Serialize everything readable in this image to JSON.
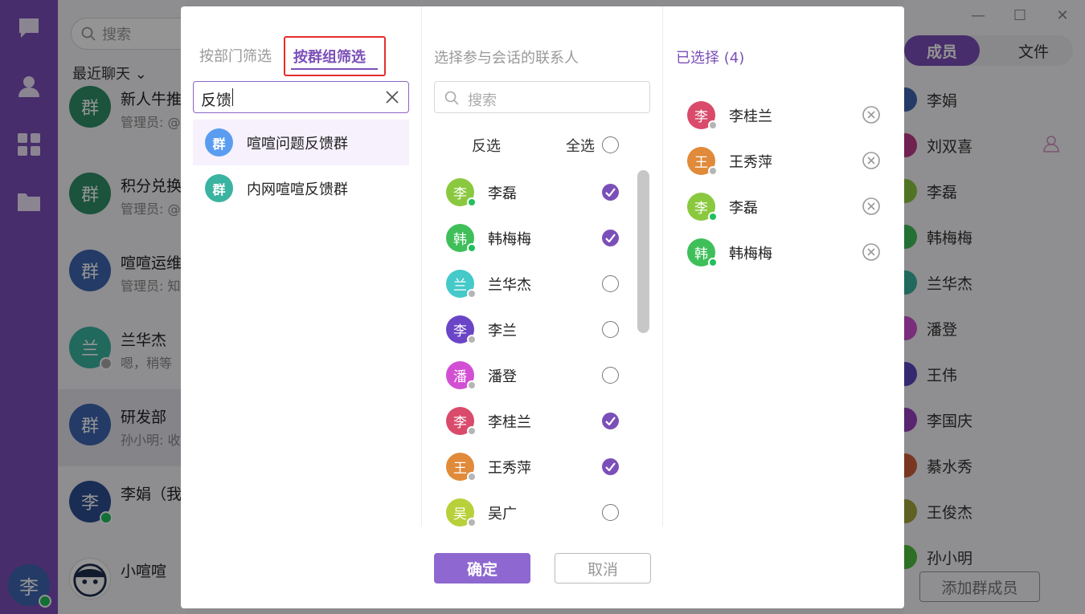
{
  "background": {
    "search_placeholder": "搜索",
    "recent_label": "最近聊天",
    "chats": [
      {
        "avatar": "群",
        "name": "新人牛推",
        "preview": "管理员: @",
        "color": "#2f8f6a"
      },
      {
        "avatar": "群",
        "name": "积分兑换",
        "preview": "管理员: @",
        "color": "#2f8f6a"
      },
      {
        "avatar": "群",
        "name": "喧喧运维",
        "preview": "管理员: 知",
        "color": "#3d67b0"
      },
      {
        "avatar": "兰",
        "name": "兰华杰",
        "preview": "嗯，稍等",
        "color": "#3ab3a0"
      },
      {
        "avatar": "群",
        "name": "研发部",
        "preview": "孙小明: 收",
        "color": "#3d67b0"
      },
      {
        "avatar": "李",
        "name": "李娟（我",
        "preview": "",
        "color": "#2b4f93"
      },
      {
        "avatar": "",
        "name": "小喧喧",
        "preview": "",
        "color": "#ffffff"
      }
    ],
    "self_avatar": "李",
    "window_controls": {
      "minimize": "—",
      "maximize": "☐",
      "close": "✕"
    },
    "tabs": {
      "members": "成员",
      "files": "文件"
    },
    "members": [
      {
        "name": "李娟",
        "color": "#3d67b0"
      },
      {
        "name": "刘双喜",
        "color": "#c0398a"
      },
      {
        "name": "李磊",
        "color": "#8ac93f"
      },
      {
        "name": "韩梅梅",
        "color": "#3fbf5a"
      },
      {
        "name": "兰华杰",
        "color": "#3ab3a0"
      },
      {
        "name": "潘登",
        "color": "#d24fd4"
      },
      {
        "name": "王伟",
        "color": "#5b46c2"
      },
      {
        "name": "李国庆",
        "color": "#9a3fc2"
      },
      {
        "name": "綦水秀",
        "color": "#d0603a"
      },
      {
        "name": "王俊杰",
        "color": "#a3a83a"
      },
      {
        "name": "孙小明",
        "color": "#4fbf3f"
      }
    ],
    "add_member_label": "添加群成员"
  },
  "dialog": {
    "filter_tabs": {
      "by_department": "按部门筛选",
      "by_group": "按群组筛选"
    },
    "group_search_value": "反馈",
    "groups": [
      {
        "avatar": "群",
        "name": "喧喧问题反馈群",
        "color": "#5a9df0"
      },
      {
        "avatar": "群",
        "name": "内网喧喧反馈群",
        "color": "#3ab3a0"
      }
    ],
    "contacts_title": "选择参与会话的联系人",
    "contact_search_placeholder": "搜索",
    "invert_label": "反选",
    "select_all_label": "全选",
    "contacts": [
      {
        "avatar": "李",
        "name": "李磊",
        "color": "#8ac93f",
        "online": true,
        "checked": true
      },
      {
        "avatar": "韩",
        "name": "韩梅梅",
        "color": "#3fbf5a",
        "online": true,
        "checked": true
      },
      {
        "avatar": "兰",
        "name": "兰华杰",
        "color": "#45c9c9",
        "online": false,
        "checked": false
      },
      {
        "avatar": "李",
        "name": "李兰",
        "color": "#6a45c7",
        "online": false,
        "checked": false
      },
      {
        "avatar": "潘",
        "name": "潘登",
        "color": "#d24fd4",
        "online": false,
        "checked": false
      },
      {
        "avatar": "李",
        "name": "李桂兰",
        "color": "#d94a6b",
        "online": false,
        "checked": true
      },
      {
        "avatar": "王",
        "name": "王秀萍",
        "color": "#e08a3a",
        "online": false,
        "checked": true
      },
      {
        "avatar": "吴",
        "name": "吴广",
        "color": "#b8d03a",
        "online": false,
        "checked": false
      }
    ],
    "selected_title": "已选择 (4)",
    "selected": [
      {
        "avatar": "李",
        "name": "李桂兰",
        "color": "#d94a6b",
        "online": false
      },
      {
        "avatar": "王",
        "name": "王秀萍",
        "color": "#e08a3a",
        "online": false
      },
      {
        "avatar": "李",
        "name": "李磊",
        "color": "#8ac93f",
        "online": true
      },
      {
        "avatar": "韩",
        "name": "韩梅梅",
        "color": "#3fbf5a",
        "online": true
      }
    ],
    "confirm_label": "确定",
    "cancel_label": "取消"
  }
}
